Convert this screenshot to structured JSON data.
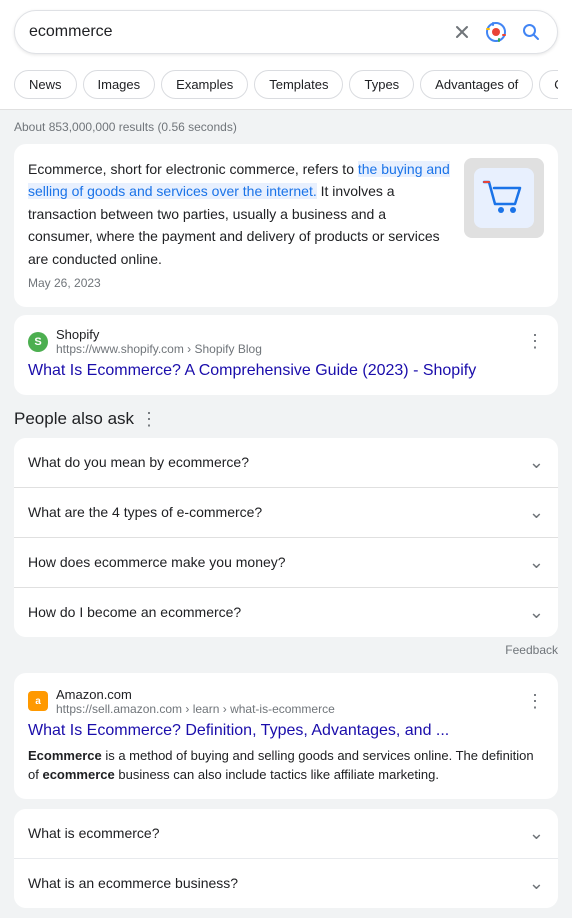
{
  "searchBar": {
    "query": "ecommerce",
    "clearLabel": "×",
    "googleLensLabel": "Google Lens",
    "searchLabel": "Search"
  },
  "filterTabs": [
    {
      "id": "news",
      "label": "News",
      "active": false
    },
    {
      "id": "images",
      "label": "Images",
      "active": false
    },
    {
      "id": "examples",
      "label": "Examples",
      "active": false
    },
    {
      "id": "templates",
      "label": "Templates",
      "active": false
    },
    {
      "id": "types",
      "label": "Types",
      "active": false
    },
    {
      "id": "advantages",
      "label": "Advantages of",
      "active": false
    },
    {
      "id": "or-ecommerce",
      "label": "Or e-commerce",
      "active": false
    }
  ],
  "resultsCount": "About 853,000,000 results (0.56 seconds)",
  "featuredSnippet": {
    "text1": "Ecommerce, short for electronic commerce, refers to ",
    "highlighted": "the buying and selling of goods and services over the internet.",
    "text2": " It involves a transaction between two parties, usually a business and a consumer, where the payment and delivery of products or services are conducted online.",
    "date": "May 26, 2023"
  },
  "sourceCard": {
    "favicon": "S",
    "faviconBg": "#4caf50",
    "name": "Shopify",
    "url": "https://www.shopify.com › Shopify Blog",
    "moreIcon": "⋮",
    "linkText": "What Is Ecommerce? A Comprehensive Guide (2023) - Shopify"
  },
  "peopleAlsoAsk": {
    "title": "People also ask",
    "moreIcon": "⋮",
    "questions": [
      "What do you mean by ecommerce?",
      "What are the 4 types of e-commerce?",
      "How does ecommerce make you money?",
      "How do I become an ecommerce?"
    ]
  },
  "feedback": "Feedback",
  "amazonCard": {
    "favicon": "a",
    "faviconBg": "#ff9900",
    "name": "Amazon.com",
    "url": "https://sell.amazon.com › learn › what-is-ecommerce",
    "moreIcon": "⋮",
    "title": "What Is Ecommerce? Definition, Types, Advantages, and ...",
    "snippetParts": [
      {
        "bold": false,
        "text": ""
      },
      {
        "bold": true,
        "text": "Ecommerce"
      },
      {
        "bold": false,
        "text": " is a method of buying and selling goods and services online. The definition of "
      },
      {
        "bold": true,
        "text": "ecommerce"
      },
      {
        "bold": false,
        "text": " business can also include tactics like affiliate marketing."
      }
    ]
  },
  "bottomFaqs": [
    "What is ecommerce?",
    "What is an ecommerce business?"
  ]
}
